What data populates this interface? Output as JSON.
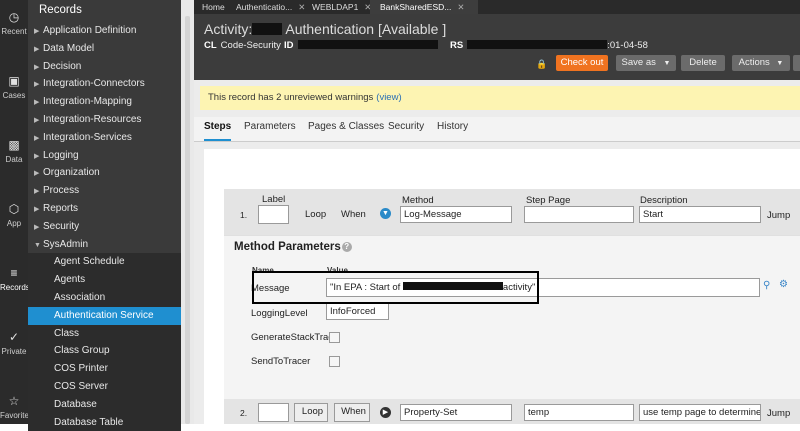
{
  "rail": [
    {
      "name": "recent",
      "label": "Recent",
      "icon": "clock"
    },
    {
      "name": "cases",
      "label": "Cases",
      "icon": "briefcase"
    },
    {
      "name": "data",
      "label": "Data",
      "icon": "bar-chart"
    },
    {
      "name": "app",
      "label": "App",
      "icon": "cube"
    },
    {
      "name": "records",
      "label": "Records",
      "icon": "layers"
    },
    {
      "name": "private",
      "label": "Private",
      "icon": "check"
    },
    {
      "name": "favorite",
      "label": "Favorite",
      "icon": "star"
    }
  ],
  "nav": {
    "title": "Records",
    "items": [
      "Application Definition",
      "Data Model",
      "Decision",
      "Integration-Connectors",
      "Integration-Mapping",
      "Integration-Resources",
      "Integration-Services",
      "Logging",
      "Organization",
      "Process",
      "Reports",
      "Security",
      "SysAdmin"
    ],
    "sub_items": [
      "Agent Schedule",
      "Agents",
      "Association",
      "Authentication Service",
      "Class",
      "Class Group",
      "COS Printer",
      "COS Server",
      "Database",
      "Database Table"
    ],
    "selected": "Authentication Service"
  },
  "tabs": [
    {
      "label": "Home",
      "close": false
    },
    {
      "label": "Authenticatio...",
      "close": true
    },
    {
      "label": "WEBLDAP1",
      "close": true
    },
    {
      "label": "BankSharedESD...",
      "close": true
    }
  ],
  "header": {
    "title_prefix": "Activity:",
    "title_suffix": "Authentication [Available ]",
    "cl_label": "CL",
    "cl_value": "Code-Security",
    "id_label": "ID",
    "rs_label": "RS",
    "rs_suffix": ":01-04-58",
    "buttons": {
      "checkout": "Check out",
      "saveas": "Save as",
      "delete": "Delete",
      "actions": "Actions"
    }
  },
  "warning": {
    "text": "This record has  2 unreviewed warnings",
    "link": "(view)"
  },
  "subtabs": [
    "Steps",
    "Parameters",
    "Pages & Classes",
    "Security",
    "History"
  ],
  "step1": {
    "number": "1.",
    "col_label": "Label",
    "loop": "Loop",
    "when": "When",
    "col_method": "Method",
    "method": "Log-Message",
    "col_steppage": "Step Page",
    "step_page": "",
    "col_description": "Description",
    "description": "Start",
    "jump": "Jump"
  },
  "method_params": {
    "title": "Method Parameters",
    "col_name": "Name",
    "col_value": "Value",
    "rows": [
      {
        "name": "Message",
        "value_prefix": "\"In EPA : Start of ",
        "value_suffix": "activity\""
      },
      {
        "name": "LoggingLevel",
        "value": "InfoForced"
      },
      {
        "name": "GenerateStackTrace"
      },
      {
        "name": "SendToTracer"
      }
    ]
  },
  "step2": {
    "number": "2.",
    "loop": "Loop",
    "when": "When",
    "method": "Property-Set",
    "step_page": "temp",
    "description": "use temp page to determine if",
    "jump": "Jump"
  }
}
